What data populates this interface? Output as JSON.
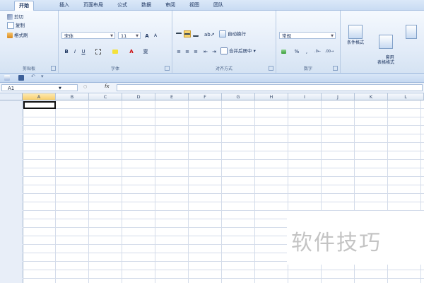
{
  "tabs": [
    "开始",
    "插入",
    "页面布局",
    "公式",
    "数据",
    "审阅",
    "视图",
    "团队"
  ],
  "active_tab": "开始",
  "clipboard": {
    "cut": "剪切",
    "copy": "复制",
    "format_painter": "格式刷",
    "label": "剪贴板"
  },
  "font": {
    "name": "宋体",
    "size": "11",
    "bold": "B",
    "italic": "I",
    "underline": "U",
    "grow": "A",
    "shrink": "A",
    "phonetic": "雯",
    "label": "字体"
  },
  "alignment": {
    "wrap_text": "自动换行",
    "merge_center": "合并后居中",
    "label": "对齐方式"
  },
  "number": {
    "format": "常规",
    "percent": "%",
    "comma": ",",
    "label": "数字"
  },
  "styles": {
    "conditional": "条件格式",
    "table_format": "套用\n表格格式"
  },
  "name_box": "A1",
  "fx_label": "fx",
  "columns": [
    "A",
    "B",
    "C",
    "D",
    "E",
    "F",
    "G",
    "H",
    "I",
    "J",
    "K",
    "L"
  ],
  "selected_column": "A",
  "watermark": "软件技巧",
  "colors": {
    "ribbon_bg": "#dfe9f6",
    "selected_header": "#f8cf6c",
    "grid_line": "#d4dcea"
  }
}
